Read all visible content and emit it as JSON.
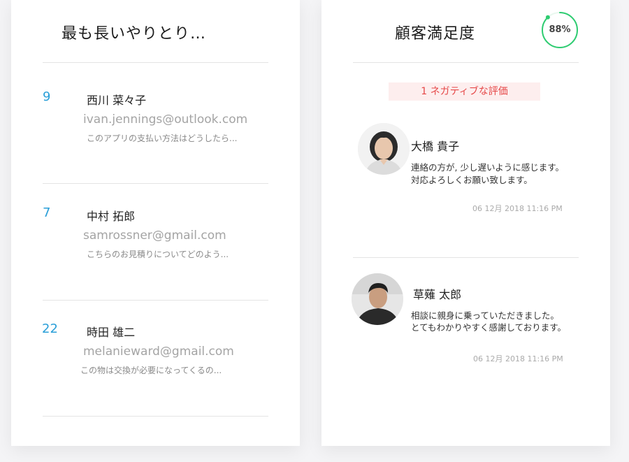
{
  "longest_conversations": {
    "title": "最も長いやりとり…",
    "items": [
      {
        "count": "9",
        "name": "西川 菜々子",
        "email": "ivan.jennings@outlook.com",
        "snippet": "このアプリの支払い方法はどうしたら..."
      },
      {
        "count": "7",
        "name": "中村 拓郎",
        "email": "samrossner@gmail.com",
        "snippet": "こちらのお見積りについてどのよう..."
      },
      {
        "count": "22",
        "name": "時田 雄二",
        "email": "melanieward@gmail.com",
        "snippet": "この物は交換が必要になってくるの..."
      }
    ]
  },
  "satisfaction": {
    "title": "顧客満足度",
    "score_label": "88%",
    "score_value": 88,
    "accent_color": "#2ecc71",
    "negative_badge": "1 ネガティブな評価",
    "reviews": [
      {
        "name": "大橋 貴子",
        "line1": "連絡の方が, 少し遅いように感じます。",
        "line2": "対応よろしくお願い致します。",
        "time": "06 12月 2018 11:16 PM"
      },
      {
        "name": "草薙 太郎",
        "line1": "相談に親身に乗っていただきました。",
        "line2": "とてもわかりやすく感謝しております。",
        "time": "06 12月 2018 11:16 PM"
      }
    ]
  }
}
